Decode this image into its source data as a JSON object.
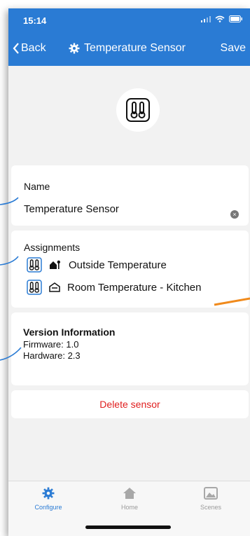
{
  "status_bar": {
    "time": "15:14"
  },
  "nav": {
    "back_label": "Back",
    "title": "Temperature Sensor",
    "save_label": "Save"
  },
  "name_card": {
    "label": "Name",
    "value": "Temperature Sensor"
  },
  "assignments": {
    "label": "Assignments",
    "items": [
      {
        "label": "Outside Temperature",
        "icon": "outdoor-house-icon"
      },
      {
        "label": "Room Temperature - Kitchen",
        "icon": "room-icon"
      }
    ]
  },
  "version": {
    "title": "Version Information",
    "firmware": "Firmware: 1.0",
    "hardware": "Hardware: 2.3"
  },
  "delete_label": "Delete sensor",
  "tabs": [
    {
      "label": "Configure",
      "icon": "gear-icon",
      "active": true
    },
    {
      "label": "Home",
      "icon": "home-icon",
      "active": false
    },
    {
      "label": "Scenes",
      "icon": "scenes-icon",
      "active": false
    }
  ],
  "colors": {
    "accent": "#2a7bd4",
    "danger": "#e02020",
    "callout_blue": "#2a7bd4",
    "callout_orange": "#f08a1c"
  }
}
